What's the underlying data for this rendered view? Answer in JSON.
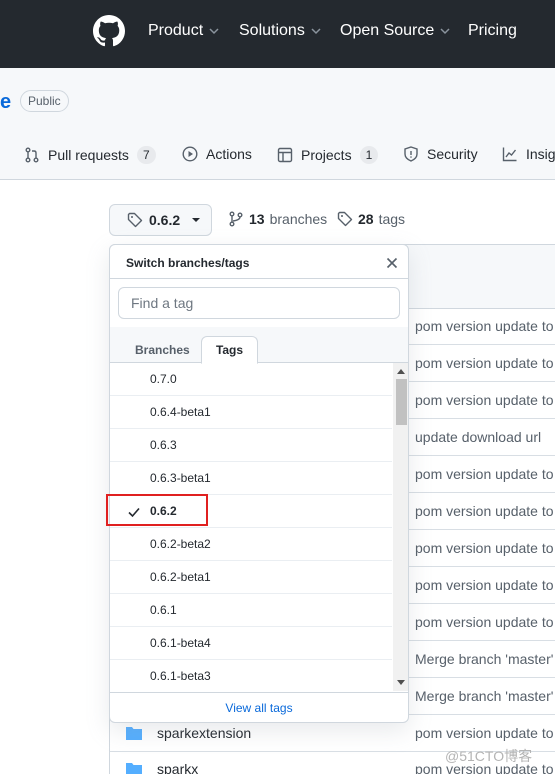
{
  "header": {
    "nav": [
      "Product",
      "Solutions",
      "Open Source",
      "Pricing"
    ]
  },
  "repo": {
    "name_tail": "e",
    "visibility": "Public"
  },
  "tabs": [
    {
      "label": "Pull requests",
      "count": "7"
    },
    {
      "label": "Actions"
    },
    {
      "label": "Projects",
      "count": "1"
    },
    {
      "label": "Security"
    },
    {
      "label": "Insig"
    }
  ],
  "branch_bar": {
    "current": "0.6.2",
    "branches_count": "13",
    "branches_label": "branches",
    "tags_count": "28",
    "tags_label": "tags"
  },
  "dropdown": {
    "title": "Switch branches/tags",
    "filter_placeholder": "Find a tag",
    "tab_branches": "Branches",
    "tab_tags": "Tags",
    "items": [
      "0.7.0",
      "0.6.4-beta1",
      "0.6.3",
      "0.6.3-beta1",
      "0.6.2",
      "0.6.2-beta2",
      "0.6.2-beta1",
      "0.6.1",
      "0.6.1-beta4",
      "0.6.1-beta3"
    ],
    "selected": "0.6.2",
    "footer": "View all tags"
  },
  "files": {
    "commit_messages": [
      "pom version update to",
      "pom version update to",
      "pom version update to",
      "update download url",
      "pom version update to",
      "pom version update to",
      "pom version update to",
      "pom version update to",
      "pom version update to",
      "Merge branch 'master'",
      "Merge branch 'master'",
      "pom version update to",
      "pom version update to"
    ],
    "folders": [
      "sparkextension",
      "sparkx"
    ]
  },
  "watermark": "@51CTO博客"
}
